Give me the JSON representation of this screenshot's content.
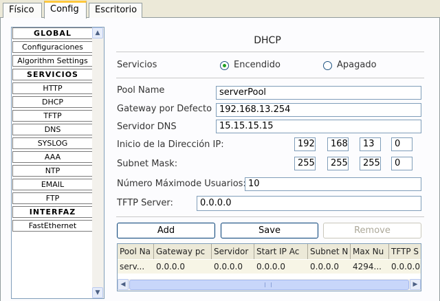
{
  "tabs": [
    {
      "label": "Físico"
    },
    {
      "label": "Config"
    },
    {
      "label": "Escritorio"
    }
  ],
  "left_list": {
    "items": [
      {
        "label": "GLOBAL",
        "header": true
      },
      {
        "label": "Configuraciones",
        "header": false
      },
      {
        "label": "Algorithm Settings",
        "header": false
      },
      {
        "label": "SERVICIOS",
        "header": true
      },
      {
        "label": "HTTP",
        "header": false
      },
      {
        "label": "DHCP",
        "header": false
      },
      {
        "label": "TFTP",
        "header": false
      },
      {
        "label": "DNS",
        "header": false
      },
      {
        "label": "SYSLOG",
        "header": false
      },
      {
        "label": "AAA",
        "header": false
      },
      {
        "label": "NTP",
        "header": false
      },
      {
        "label": "EMAIL",
        "header": false
      },
      {
        "label": "FTP",
        "header": false
      },
      {
        "label": "INTERFAZ",
        "header": true
      },
      {
        "label": "FastEthernet",
        "header": false
      }
    ]
  },
  "dhcp": {
    "title": "DHCP",
    "services_label": "Servicios",
    "on_label": "Encendido",
    "off_label": "Apagado",
    "selected": "on",
    "pool_name_label": "Pool Name",
    "pool_name": "serverPool",
    "gateway_label": "Gateway por Defecto",
    "gateway": "192.168.13.254",
    "dns_label": "Servidor DNS",
    "dns": "15.15.15.15",
    "start_ip_label": "Inicio de la Dirección IP:",
    "start_ip": [
      "192",
      "168",
      "13",
      "0"
    ],
    "mask_label": "Subnet Mask:",
    "mask": [
      "255",
      "255",
      "255",
      "0"
    ],
    "max_users_label": "Número Máximode Usuarios:",
    "max_users": "10",
    "tftp_label": "TFTP Server:",
    "tftp": "0.0.0.0",
    "add_label": "Add",
    "save_label": "Save",
    "remove_label": "Remove"
  },
  "table": {
    "columns": [
      "Pool Na",
      "Gateway pc",
      "Servidor",
      "Start IP Ac",
      "Subnet N",
      "Max Nu",
      "TFTP S"
    ],
    "rows": [
      [
        "serv...",
        "0.0.0.0",
        "0.0.0.0",
        "0.0.0.0",
        "0.0.0.0",
        "4294...",
        "0.0.0.0"
      ]
    ]
  },
  "colors": {
    "tab_active_accent": "#ffc83c",
    "radio_selected": "#21a121",
    "field_border": "#7f9db9",
    "button_border": "#003c74"
  }
}
